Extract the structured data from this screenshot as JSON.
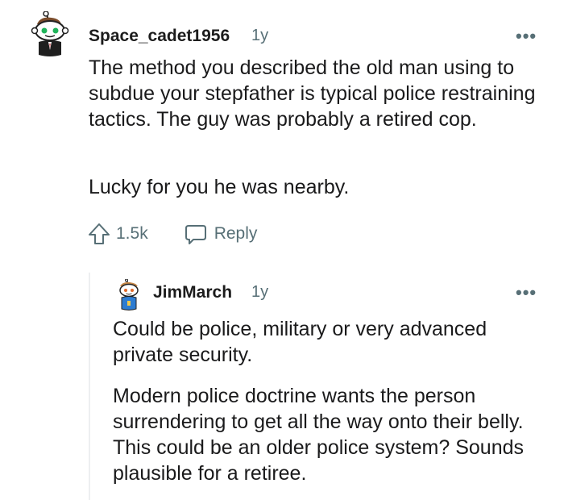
{
  "comments": [
    {
      "username": "Space_cadet1956",
      "age": "1y",
      "overflow": "•••",
      "paragraphs": [
        "The method you described the old man using to subdue your stepfather is typical police restraining tactics. The guy was probably a retired cop.",
        "Lucky for you he was nearby."
      ],
      "upvotes": "1.5k",
      "reply_label": "Reply",
      "avatar_icon": "snoo-avatar-green-eyes-icon"
    },
    {
      "username": "JimMarch",
      "age": "1y",
      "overflow": "•••",
      "paragraphs": [
        "Could be police, military or very advanced private security.",
        "Modern police doctrine wants the person surrendering to get all the way onto their belly. This could be an older police system? Sounds plausible for a retiree."
      ],
      "avatar_icon": "snoo-avatar-blue-icon"
    }
  ],
  "colors": {
    "text": "#1a1a1b",
    "meta": "#576f76",
    "thread": "#edeff1"
  }
}
